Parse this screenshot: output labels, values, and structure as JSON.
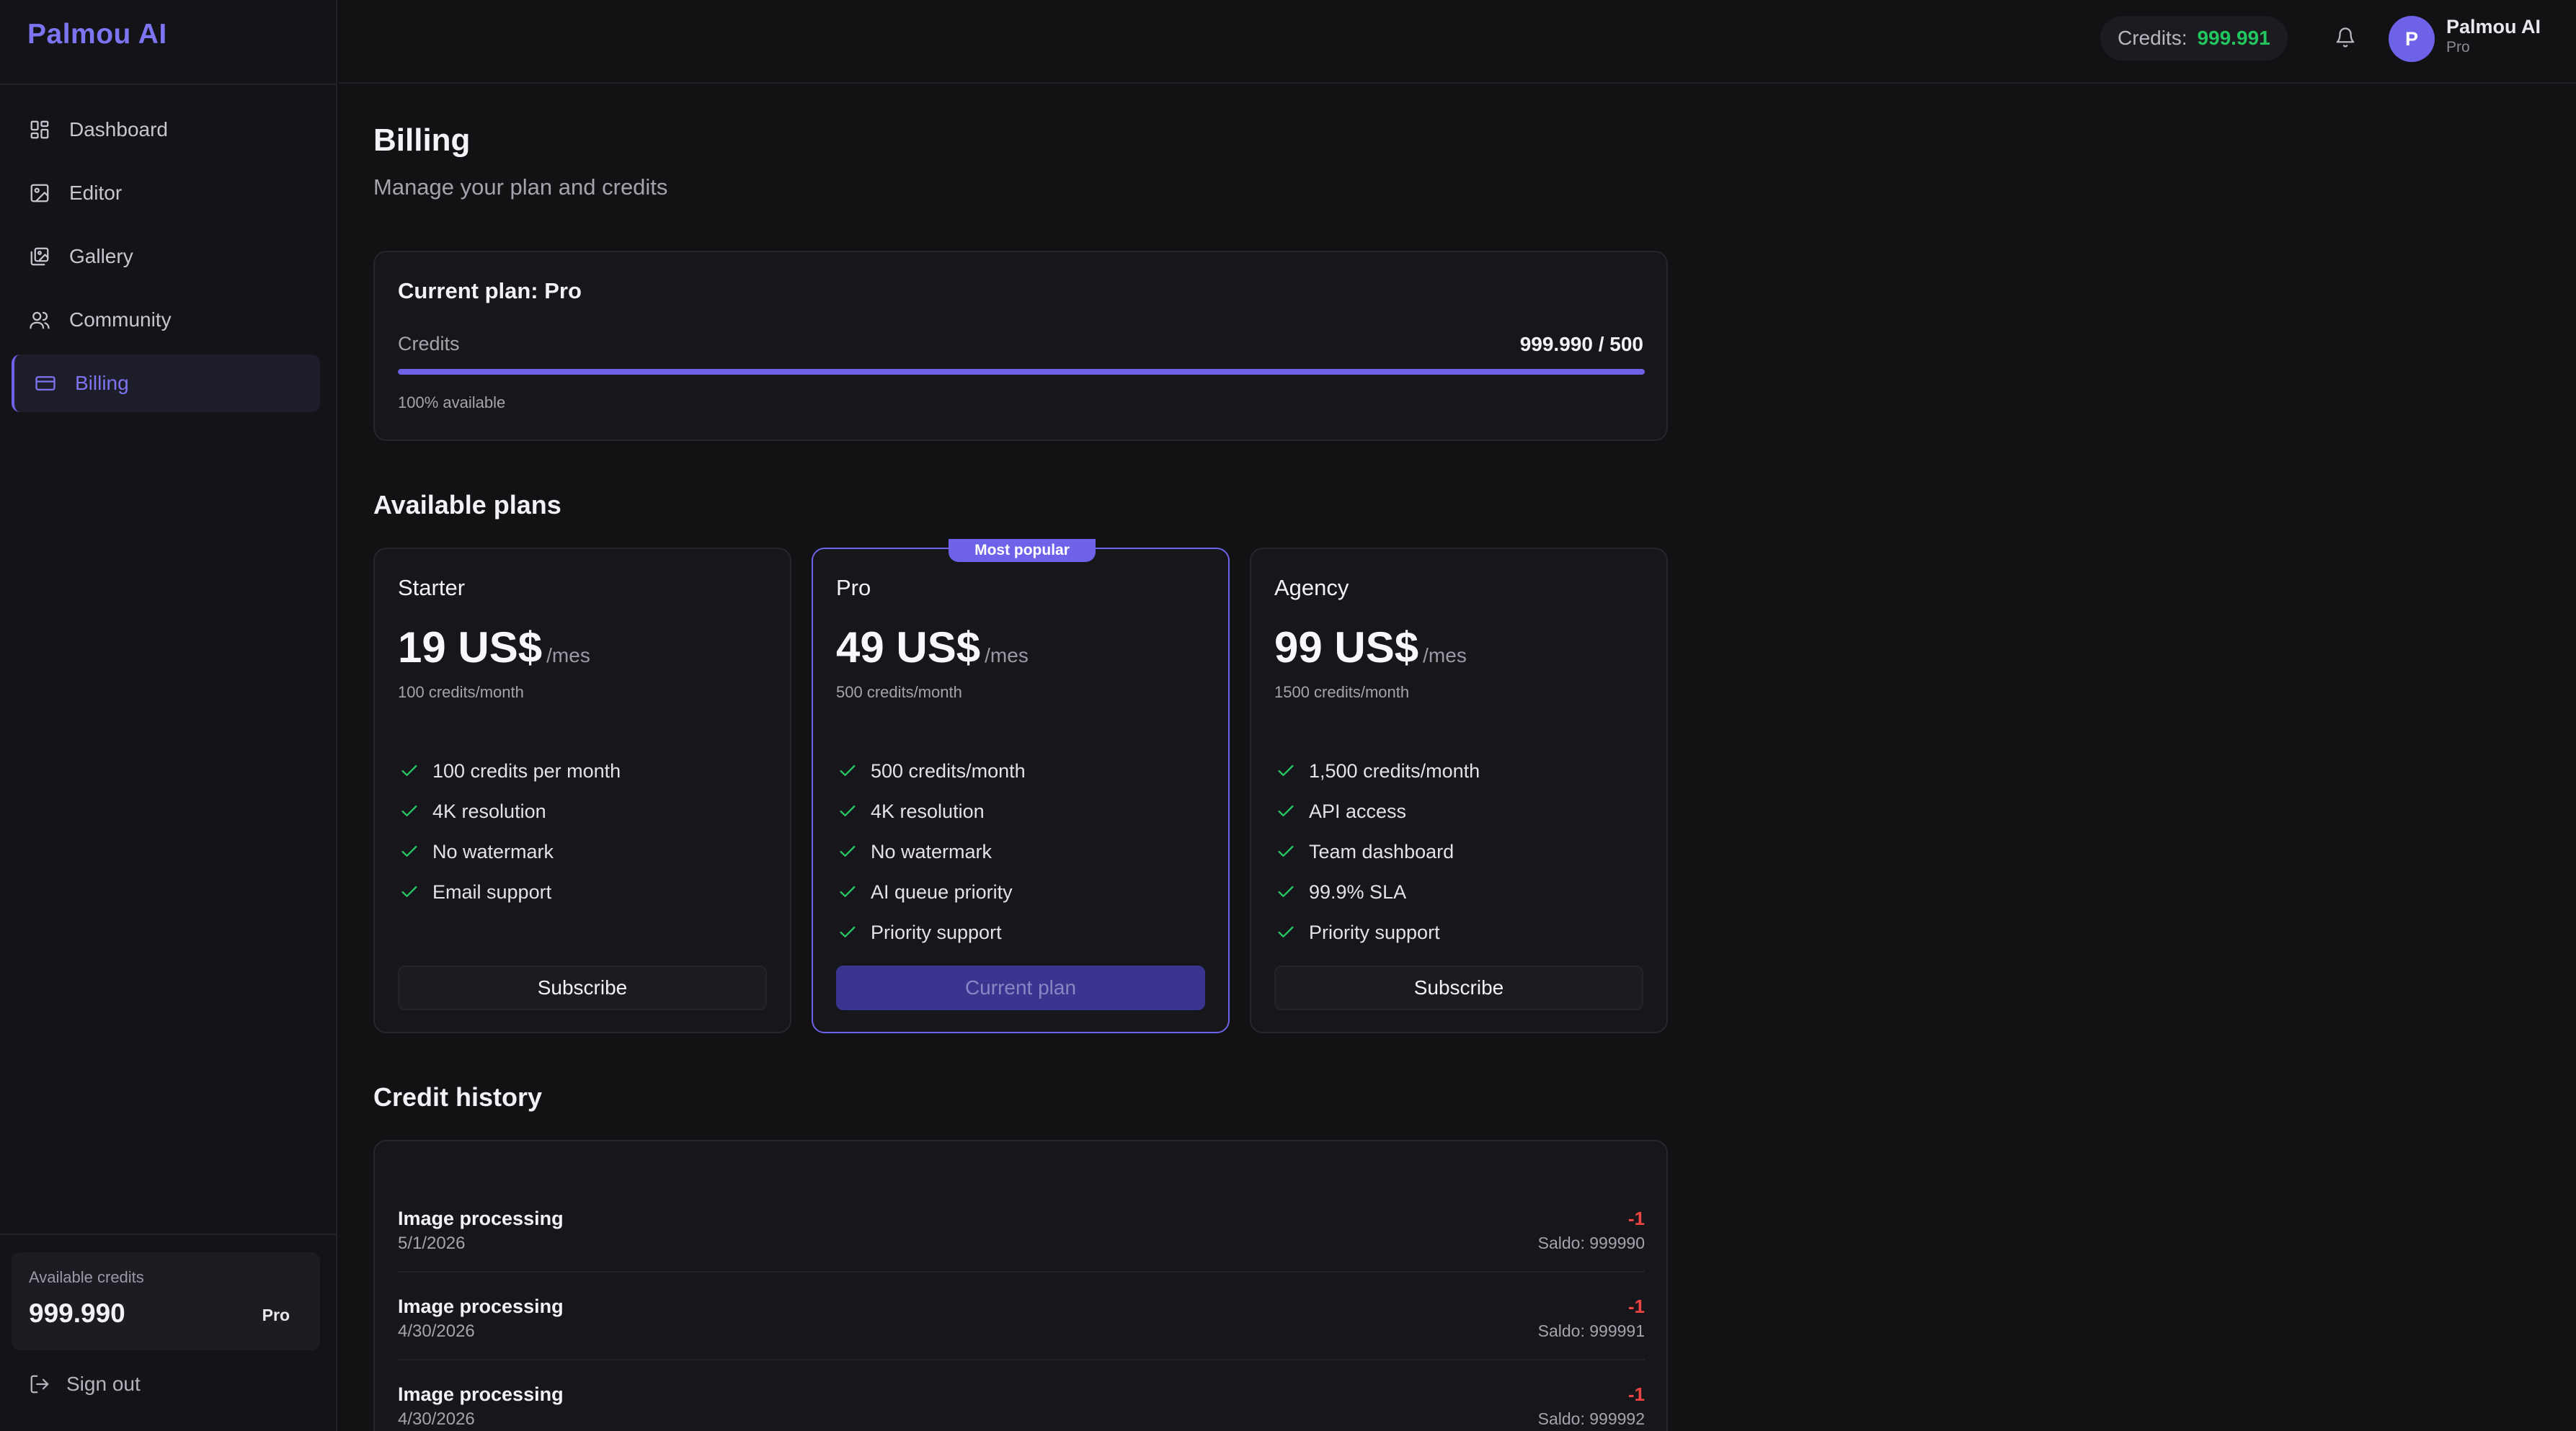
{
  "app": {
    "brand": "Palmou AI"
  },
  "sidebar": {
    "items": [
      {
        "label": "Dashboard",
        "icon": "grid-icon",
        "active": false
      },
      {
        "label": "Editor",
        "icon": "image-icon",
        "active": false
      },
      {
        "label": "Gallery",
        "icon": "images-icon",
        "active": false
      },
      {
        "label": "Community",
        "icon": "users-icon",
        "active": false
      },
      {
        "label": "Billing",
        "icon": "credit-card-icon",
        "active": true
      }
    ],
    "credits_box": {
      "label": "Available credits",
      "value": "999.990",
      "plan": "Pro"
    },
    "signout_label": "Sign out"
  },
  "header": {
    "credits_label": "Credits:",
    "credits_value": "999.991",
    "user": {
      "initial": "P",
      "name": "Palmou AI",
      "plan": "Pro"
    }
  },
  "page": {
    "title": "Billing",
    "subtitle": "Manage your plan and credits"
  },
  "current_plan": {
    "title": "Current plan: Pro",
    "credits_label": "Credits",
    "credits_value": "999.990 / 500",
    "progress_fraction": 1.0,
    "available_text": "100% available"
  },
  "plans_section_title": "Available plans",
  "plans": [
    {
      "name": "Starter",
      "price": "19 US$",
      "period": "/mes",
      "credits": "100 credits/month",
      "features": [
        "100 credits per month",
        "4K resolution",
        "No watermark",
        "Email support"
      ],
      "button": "Subscribe",
      "current": false,
      "badge": ""
    },
    {
      "name": "Pro",
      "price": "49 US$",
      "period": "/mes",
      "credits": "500 credits/month",
      "features": [
        "500 credits/month",
        "4K resolution",
        "No watermark",
        "AI queue priority",
        "Priority support"
      ],
      "button": "Current plan",
      "current": true,
      "badge": "Most popular"
    },
    {
      "name": "Agency",
      "price": "99 US$",
      "period": "/mes",
      "credits": "1500 credits/month",
      "features": [
        "1,500 credits/month",
        "API access",
        "Team dashboard",
        "99.9% SLA",
        "Priority support"
      ],
      "button": "Subscribe",
      "current": false,
      "badge": ""
    }
  ],
  "history_section_title": "Credit history",
  "history": [
    {
      "title": "Image processing",
      "date": "5/1/2026",
      "amount": "-1",
      "balance": "Saldo: 999990"
    },
    {
      "title": "Image processing",
      "date": "4/30/2026",
      "amount": "-1",
      "balance": "Saldo: 999991"
    },
    {
      "title": "Image processing",
      "date": "4/30/2026",
      "amount": "-1",
      "balance": "Saldo: 999992"
    }
  ],
  "colors": {
    "accent": "#6d62e8",
    "brand": "#7c74f0",
    "positive": "#22c55e",
    "negative": "#ef4444",
    "background": "#121215"
  }
}
